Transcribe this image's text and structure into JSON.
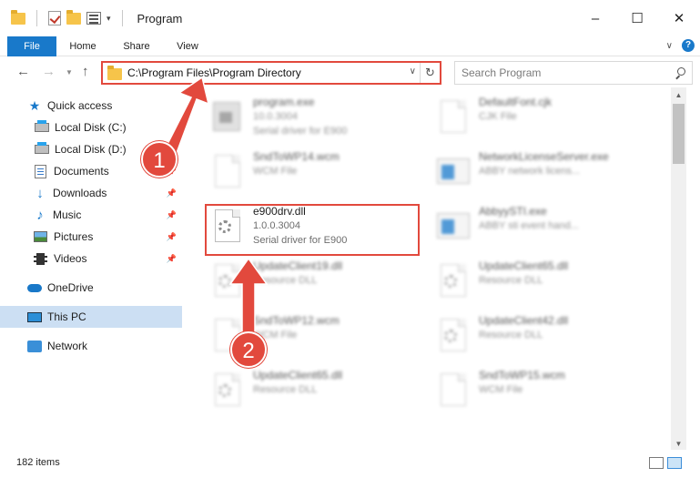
{
  "window": {
    "title": "Program",
    "minimize": "–",
    "maximize": "☐",
    "close": "✕"
  },
  "ribbon": {
    "tabs": [
      {
        "label": "File"
      },
      {
        "label": "Home"
      },
      {
        "label": "Share"
      },
      {
        "label": "View"
      }
    ],
    "help": "?"
  },
  "navigation": {
    "address_path": "C:\\Program Files\\Program Directory",
    "search_placeholder": "Search Program"
  },
  "sidebar": {
    "items": [
      {
        "label": "Quick access",
        "icon": "star-icon"
      },
      {
        "label": "Local Disk (C:)",
        "icon": "disk-icon"
      },
      {
        "label": "Local Disk (D:)",
        "icon": "disk-icon"
      },
      {
        "label": "Documents",
        "icon": "documents-icon",
        "pinned": true
      },
      {
        "label": "Downloads",
        "icon": "download-icon",
        "pinned": true
      },
      {
        "label": "Music",
        "icon": "music-icon",
        "pinned": true
      },
      {
        "label": "Pictures",
        "icon": "pictures-icon",
        "pinned": true
      },
      {
        "label": "Videos",
        "icon": "videos-icon",
        "pinned": true
      },
      {
        "label": "OneDrive",
        "icon": "onedrive-icon"
      },
      {
        "label": "This PC",
        "icon": "pc-icon",
        "selected": true
      },
      {
        "label": "Network",
        "icon": "network-icon"
      }
    ]
  },
  "files": [
    {
      "name": "program.exe",
      "line2": "10.0.3004",
      "line3": "Serial driver for E900",
      "icon": "app-icon"
    },
    {
      "name": "DefaultFont.cjk",
      "line2": "CJK File",
      "line3": "",
      "icon": "file-icon"
    },
    {
      "name": "SndToWP14.wcm",
      "line2": "WCM File",
      "line3": "",
      "icon": "file-icon"
    },
    {
      "name": "NetworkLicenseServer.exe",
      "line2": "ABBY network licens...",
      "line3": "",
      "icon": "exe-icon"
    },
    {
      "name": "e900drv.dll",
      "line2": "1.0.0.3004",
      "line3": "Serial driver for E900",
      "icon": "dll-icon"
    },
    {
      "name": "AbbyySTI.exe",
      "line2": "ABBY sti event hand...",
      "line3": "",
      "icon": "exe-icon"
    },
    {
      "name": "UpdateClient19.dll",
      "line2": "Resource DLL",
      "line3": "",
      "icon": "dll-icon"
    },
    {
      "name": "UpdateClient65.dll",
      "line2": "Resource DLL",
      "line3": "",
      "icon": "dll-icon"
    },
    {
      "name": "SndToWP12.wcm",
      "line2": "WCM File",
      "line3": "",
      "icon": "file-icon"
    },
    {
      "name": "UpdateClient42.dll",
      "line2": "Resource DLL",
      "line3": "",
      "icon": "dll-icon"
    },
    {
      "name": "UpdateClient65.dll",
      "line2": "Resource DLL",
      "line3": "",
      "icon": "dll-icon"
    },
    {
      "name": "SndToWP15.wcm",
      "line2": "WCM File",
      "line3": "",
      "icon": "file-icon"
    }
  ],
  "status": {
    "item_count": "182 items"
  },
  "annotations": {
    "step1": "1",
    "step2": "2",
    "color": "#e2493d"
  }
}
